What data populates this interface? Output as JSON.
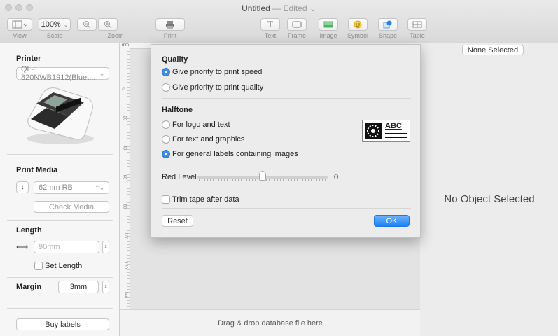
{
  "window": {
    "title": "Untitled",
    "edited": "— Edited ⌄"
  },
  "toolbar": {
    "view_label": "View",
    "scale_value": "100%",
    "scale_label": "Scale",
    "zoom_label": "Zoom",
    "print_label": "Print",
    "text_label": "Text",
    "frame_label": "Frame",
    "image_label": "Image",
    "symbol_label": "Symbol",
    "shape_label": "Shape",
    "table_label": "Table"
  },
  "left_panel": {
    "printer_heading": "Printer",
    "printer_select": "QL-820NWB1912(Bluet...",
    "print_media_heading": "Print Media",
    "media_select": "62mm RB",
    "check_media_label": "Check Media",
    "length_heading": "Length",
    "length_value": "90mm",
    "set_length_label": "Set Length",
    "margin_heading": "Margin",
    "margin_value": "3mm",
    "buy_labels": "Buy labels"
  },
  "ruler": {
    "unit": "mm",
    "marks": [
      "0",
      "20",
      "40",
      "60",
      "80",
      "100",
      "120",
      "140"
    ]
  },
  "canvas": {
    "drop_text": "Drag & drop database file here"
  },
  "right_panel": {
    "none_selected": "None Selected",
    "no_object": "No Object Selected"
  },
  "dialog": {
    "quality_heading": "Quality",
    "quality_options": [
      "Give priority to print speed",
      "Give priority to print quality"
    ],
    "quality_selected": 0,
    "halftone_heading": "Halftone",
    "halftone_options": [
      "For logo and text",
      "For text and graphics",
      "For general labels containing images"
    ],
    "halftone_selected": 2,
    "sample_text": "ABC",
    "red_level_label": "Red Level",
    "red_level_value": "0",
    "red_level_fraction": 0.5,
    "trim_label": "Trim tape after data",
    "reset_label": "Reset",
    "ok_label": "OK"
  },
  "colors": {
    "accent": "#1a82fb"
  }
}
